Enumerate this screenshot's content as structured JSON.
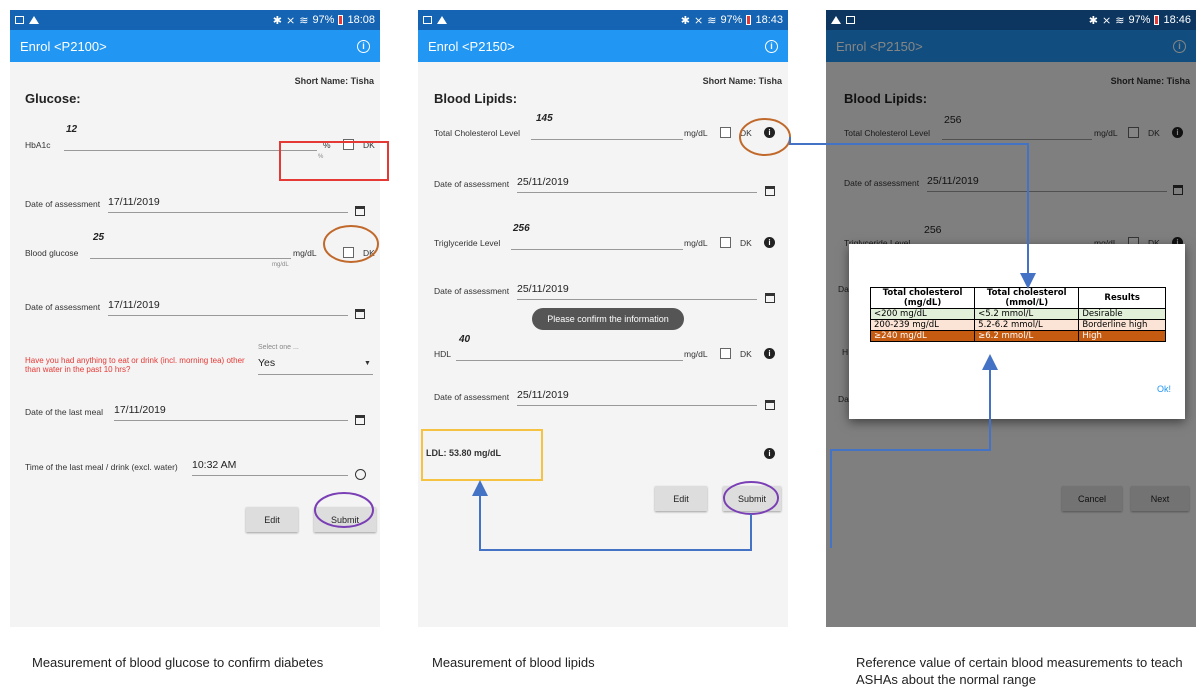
{
  "screens": [
    {
      "status": {
        "battery": "97%",
        "time": "18:08"
      },
      "title": "Enrol <P2100>",
      "short_name": "Short Name: Tisha",
      "section": "Glucose:",
      "hba1c": {
        "label": "HbA1c",
        "value": "12",
        "unit": "%",
        "hint": "%",
        "dk": "DK"
      },
      "date1": {
        "label": "Date of assessment",
        "value": "17/11/2019"
      },
      "glucose": {
        "label": "Blood glucose",
        "value": "25",
        "unit": "mg/dL",
        "hint": "mg/dL",
        "dk": "DK"
      },
      "date2": {
        "label": "Date of assessment",
        "value": "17/11/2019"
      },
      "fasting": {
        "question": "Have you had anything to eat or drink (incl. morning tea) other than water in the past 10 hrs?",
        "select_hint": "Select one ...",
        "value": "Yes"
      },
      "last_meal_date": {
        "label": "Date of the last meal",
        "value": "17/11/2019"
      },
      "last_meal_time": {
        "label": "Time of the last meal / drink (excl. water)",
        "value": "10:32 AM"
      },
      "edit": "Edit",
      "submit": "Submit"
    },
    {
      "status": {
        "battery": "97%",
        "time": "18:43"
      },
      "title": "Enrol <P2150>",
      "short_name": "Short Name: Tisha",
      "section": "Blood Lipids:",
      "tc": {
        "label": "Total Cholesterol Level",
        "value": "145",
        "unit": "mg/dL",
        "dk": "DK"
      },
      "date1": {
        "label": "Date of assessment",
        "value": "25/11/2019"
      },
      "tg": {
        "label": "Triglyceride Level",
        "value": "256",
        "unit": "mg/dL",
        "dk": "DK"
      },
      "date2": {
        "label": "Date of assessment",
        "value": "25/11/2019"
      },
      "toast": "Please confirm the information",
      "hdl": {
        "label": "HDL",
        "value": "40",
        "unit": "mg/dL",
        "dk": "DK"
      },
      "date3": {
        "label": "Date of assessment",
        "value": "25/11/2019"
      },
      "ldl": "LDL: 53.80 mg/dL",
      "edit": "Edit",
      "submit": "Submit"
    },
    {
      "status": {
        "battery": "97%",
        "time": "18:46"
      },
      "title": "Enrol <P2150>",
      "short_name": "Short Name: Tisha",
      "section": "Blood Lipids:",
      "tc": {
        "label": "Total Cholesterol Level",
        "value": "256",
        "unit": "mg/dL",
        "dk": "DK"
      },
      "date1": {
        "label": "Date of assessment",
        "value": "25/11/2019"
      },
      "tg": {
        "label": "Triglyceride Level",
        "value": "256",
        "unit": "mg/dL",
        "dk": "DK"
      },
      "d_partial": "Da",
      "h_partial": "H",
      "cancel": "Cancel",
      "next": "Next",
      "dialog": {
        "headers": [
          "Total cholesterol\n(mg/dL)",
          "Total cholesterol\n(mmol/L)",
          "Results"
        ],
        "rows": [
          [
            "<200 mg/dL",
            "<5.2 mmol/L",
            "Desirable"
          ],
          [
            "200-239 mg/dL",
            "5.2-6.2 mmol/L",
            "Borderline high"
          ],
          [
            "≥240 mg/dL",
            "≥6.2 mmol/L",
            "High"
          ]
        ],
        "ok": "Ok!"
      }
    }
  ],
  "captions": [
    "Measurement of blood glucose to confirm diabetes",
    "Measurement of blood lipids",
    "Reference value of certain blood measurements to teach ASHAs about the normal range"
  ],
  "colors": {
    "statusbar": "#1564b3",
    "appbar": "#2196f3",
    "red_box": "#e53935",
    "orange_circle": "#c0692b",
    "purple_circle": "#7b3fb5",
    "yellow_box": "#f5c242",
    "arrow": "#4472c4",
    "row_desirable": "#e2efd9",
    "row_borderline": "#fbe4d5",
    "row_high": "#c55a11"
  }
}
